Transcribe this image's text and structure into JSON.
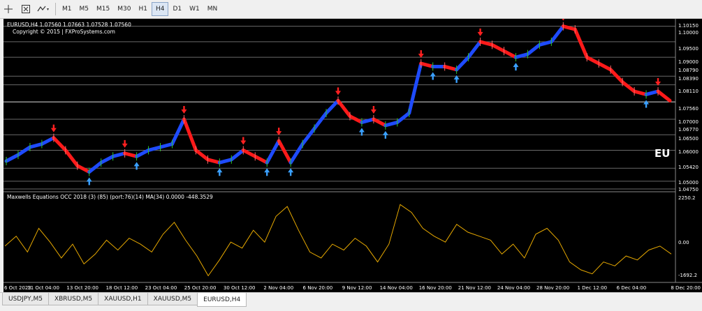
{
  "toolbar": {
    "icons": [
      "crosshair-icon",
      "period-settings-icon",
      "templates-icon"
    ],
    "periods": [
      "M1",
      "M5",
      "M15",
      "M30",
      "H1",
      "H4",
      "D1",
      "W1",
      "MN"
    ],
    "active_period": "H4"
  },
  "chart": {
    "header": "EURUSD,H4  1.07560 1.07663 1.07528 1.07560",
    "copyright": "Copyright © 2015 | FXProSystems.com",
    "big_label": "EU",
    "price_labels": [
      "1.10150",
      "1.10000",
      "1.09500",
      "1.09000",
      "1.08790",
      "1.08390",
      "1.08110",
      "1.07560",
      "1.07000",
      "1.06770",
      "1.06500",
      "1.06000",
      "1.05420",
      "1.05000",
      "1.04750"
    ],
    "current_price": "1.07560",
    "indicator_label": "Maxwells Equations OCC 2018 (3) (85) (port:76)(14) MA(34) 0.0000 -448.3529",
    "indicator_levels": [
      "2250.2",
      "0.00",
      "-1692.2"
    ],
    "time_labels": [
      "6 Oct 2023",
      "11 Oct 04:00",
      "13 Oct 20:00",
      "18 Oct 12:00",
      "23 Oct 04:00",
      "25 Oct 20:00",
      "30 Oct 12:00",
      "2 Nov 04:00",
      "6 Nov 20:00",
      "9 Nov 12:00",
      "14 Nov 04:00",
      "16 Nov 20:00",
      "21 Nov 12:00",
      "24 Nov 04:00",
      "28 Nov 20:00",
      "1 Dec 12:00",
      "6 Dec 04:00",
      "8 Dec 20:00"
    ]
  },
  "chart_data": {
    "type": "line",
    "symbol": "EURUSD",
    "timeframe": "H4",
    "ylim": [
      1.0475,
      1.1015
    ],
    "price_path": [
      1.0565,
      1.0585,
      1.061,
      1.062,
      1.064,
      1.06,
      1.055,
      1.053,
      1.056,
      1.058,
      1.059,
      1.058,
      1.06,
      1.061,
      1.062,
      1.07,
      1.06,
      1.057,
      1.056,
      1.057,
      1.06,
      1.058,
      1.056,
      1.063,
      1.056,
      1.062,
      1.067,
      1.072,
      1.076,
      1.071,
      1.069,
      1.07,
      1.068,
      1.069,
      1.072,
      1.088,
      1.087,
      1.087,
      1.086,
      1.09,
      1.095,
      1.094,
      1.092,
      1.09,
      1.091,
      1.094,
      1.095,
      1.1,
      1.099,
      1.09,
      1.088,
      1.086,
      1.082,
      1.079,
      1.078,
      1.079,
      1.076
    ],
    "indicator_range": [
      -1692.2,
      2250.2
    ],
    "indicator_path": [
      0,
      500,
      -300,
      900,
      200,
      -600,
      100,
      -900,
      -400,
      300,
      -200,
      400,
      100,
      -300,
      600,
      1200,
      300,
      -500,
      -1500,
      -700,
      200,
      -100,
      800,
      200,
      1500,
      2000,
      800,
      -300,
      -600,
      100,
      -200,
      400,
      0,
      -800,
      100,
      2100,
      1700,
      900,
      500,
      200,
      1100,
      700,
      500,
      300,
      -400,
      100,
      -600,
      600,
      900,
      300,
      -800,
      -1200,
      -1400,
      -800,
      -1000,
      -500,
      -700,
      -200,
      0,
      -400
    ]
  }
}
